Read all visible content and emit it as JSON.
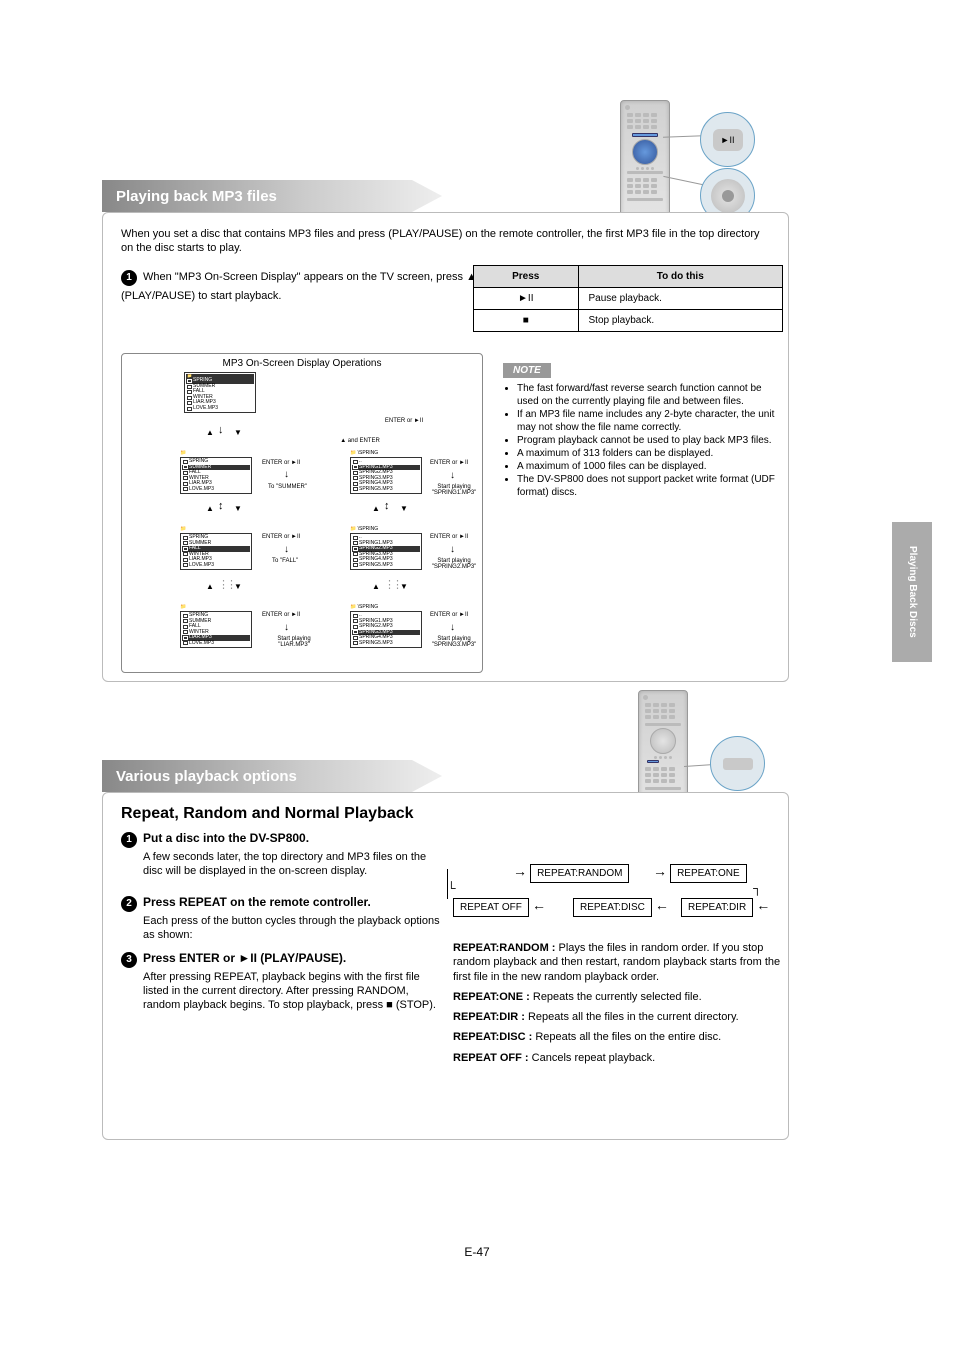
{
  "page_number": "E-47",
  "side_tab": "Playing Back Discs",
  "section1": {
    "banner": "Playing back MP3 files",
    "intro": "When you set a disc that contains MP3 files and press (PLAY/PAUSE) on the remote controller, the first MP3 file in the top directory on the disc starts to play.",
    "body": "When \"MP3 On-Screen Display\" appears on the TV screen, press ▲/▼ to select the folder or files. Then, press ENTER or ►II (PLAY/PAUSE) to start playback.",
    "diagram_title": "MP3 On-Screen Display Operations",
    "table": {
      "head1": "Press",
      "head2": "To do this",
      "r1c1": "►II",
      "r1c2": "Pause playback.",
      "r2c1": "■",
      "r2c2": "Stop playback."
    },
    "note_head": "NOTE",
    "note_items": [
      "The fast forward/fast reverse search function cannot be used on the currently playing file and between files.",
      "If an MP3 file name includes any 2-byte character, the unit may not show the file name correctly.",
      "Program playback cannot be used to play back MP3 files.",
      "A maximum of 313 folders can be displayed.",
      "A maximum of 1000 files can be displayed.",
      "The DV-SP800 does not support packet write format (UDF format) discs."
    ],
    "osd": {
      "root_label": "",
      "folders": [
        "SPRING",
        "SUMMER",
        "FALL",
        "WINTER"
      ],
      "files_root": [
        "LIAR.MP3",
        "LOVE.MP3"
      ],
      "spring_files": [
        "SPRING1.MP3",
        "SPRING2.MP3",
        "SPRING3.MP3",
        "SPRING4.MP3",
        "SPRING5.MP3"
      ],
      "up_label": "..",
      "enter_label": "ENTER or ►II",
      "nav_label": "▲ and ENTER",
      "to_summer": "To \"SUMMER\"",
      "to_fall": "To \"FALL\"",
      "start1": "Start playing \"SPRING1.MP3\"",
      "start2": "Start playing \"SPRING2.MP3\"",
      "start3": "Start playing \"SPRING3.MP3\"",
      "start_liar": "Start playing \"LIAR.MP3\""
    }
  },
  "section2": {
    "banner": "Various playback options",
    "title": "Repeat, Random and Normal Playback",
    "step1": {
      "lead": "Put a disc into the DV-SP800.",
      "body": "A few seconds later, the top directory and MP3 files on the disc will be displayed in the on-screen display."
    },
    "step2": {
      "lead": "Press REPEAT on the remote controller.",
      "body": "Each press of the button cycles through the playback options as shown:",
      "boxes": [
        "REPEAT:RANDOM",
        "REPEAT:ONE",
        "REPEAT:DIR",
        "REPEAT:DISC",
        "REPEAT OFF"
      ],
      "random": {
        "label": "REPEAT:RANDOM :",
        "text": "Plays the files in random order. If you stop random playback and then restart, random playback starts from the first file in the new random playback order."
      },
      "one": {
        "label": "REPEAT:ONE :",
        "text": "Repeats the currently selected file."
      },
      "dir": {
        "label": "REPEAT:DIR :",
        "text": "Repeats all the files in the current directory."
      },
      "disc": {
        "label": "REPEAT:DISC :",
        "text": "Repeats all the files on the entire disc."
      },
      "off": {
        "label": "REPEAT OFF :",
        "text": "Cancels repeat playback."
      }
    },
    "step3": {
      "lead": "Press ENTER or  ►II (PLAY/PAUSE).",
      "body": "After pressing REPEAT, playback begins with the first file listed in the current directory. After pressing RANDOM, random playback begins. To stop playback, press ■ (STOP)."
    }
  }
}
